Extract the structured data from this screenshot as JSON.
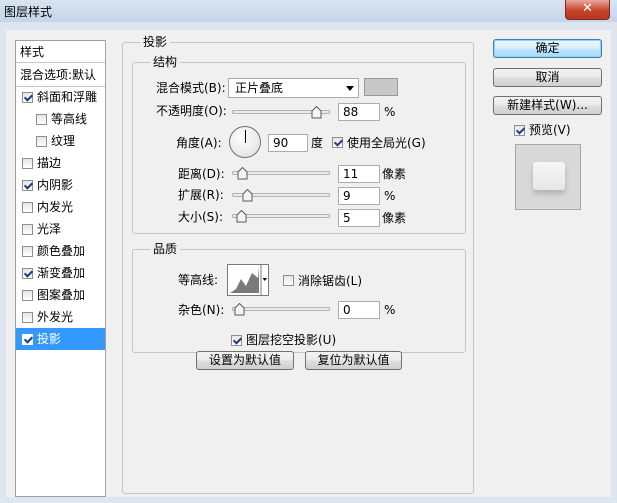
{
  "window": {
    "title": "图层样式",
    "close_label": "✕"
  },
  "sidebar": {
    "header": "样式",
    "items": [
      {
        "label": "混合选项:默认",
        "checkbox": false,
        "checked": false
      },
      {
        "label": "斜面和浮雕",
        "checkbox": true,
        "checked": true
      },
      {
        "label": "等高线",
        "checkbox": true,
        "checked": false,
        "indent": true
      },
      {
        "label": "纹理",
        "checkbox": true,
        "checked": false,
        "indent": true
      },
      {
        "label": "描边",
        "checkbox": true,
        "checked": false
      },
      {
        "label": "内阴影",
        "checkbox": true,
        "checked": true
      },
      {
        "label": "内发光",
        "checkbox": true,
        "checked": false
      },
      {
        "label": "光泽",
        "checkbox": true,
        "checked": false
      },
      {
        "label": "颜色叠加",
        "checkbox": true,
        "checked": false
      },
      {
        "label": "渐变叠加",
        "checkbox": true,
        "checked": true
      },
      {
        "label": "图案叠加",
        "checkbox": true,
        "checked": false
      },
      {
        "label": "外发光",
        "checkbox": true,
        "checked": false
      },
      {
        "label": "投影",
        "checkbox": true,
        "checked": true,
        "selected": true
      }
    ]
  },
  "panel": {
    "title": "投影",
    "structure": {
      "title": "结构",
      "blend_mode_label": "混合模式(B):",
      "blend_mode_value": "正片叠底",
      "shadow_color": "#c8c8c8",
      "opacity_label": "不透明度(O):",
      "opacity_value": "88",
      "opacity_unit": "%",
      "opacity_slider": 0.88,
      "angle_label": "角度(A):",
      "angle_value": "90",
      "angle_unit": "度",
      "global_light_label": "使用全局光(G)",
      "global_light_checked": true,
      "distance_label": "距离(D):",
      "distance_value": "11",
      "distance_unit": "像素",
      "distance_slider": 0.04,
      "spread_label": "扩展(R):",
      "spread_value": "9",
      "spread_unit": "%",
      "spread_slider": 0.09,
      "size_label": "大小(S):",
      "size_value": "5",
      "size_unit": "像素",
      "size_slider": 0.02
    },
    "quality": {
      "title": "品质",
      "contour_label": "等高线:",
      "anti_alias_label": "消除锯齿(L)",
      "anti_alias_checked": false,
      "noise_label": "杂色(N):",
      "noise_value": "0",
      "noise_unit": "%",
      "noise_slider": 0.0
    },
    "knockout_label": "图层挖空投影(U)",
    "knockout_checked": true,
    "make_default_label": "设置为默认值",
    "reset_default_label": "复位为默认值"
  },
  "buttons": {
    "ok": "确定",
    "cancel": "取消",
    "new_style": "新建样式(W)...",
    "preview_label": "预览(V)",
    "preview_checked": true
  }
}
